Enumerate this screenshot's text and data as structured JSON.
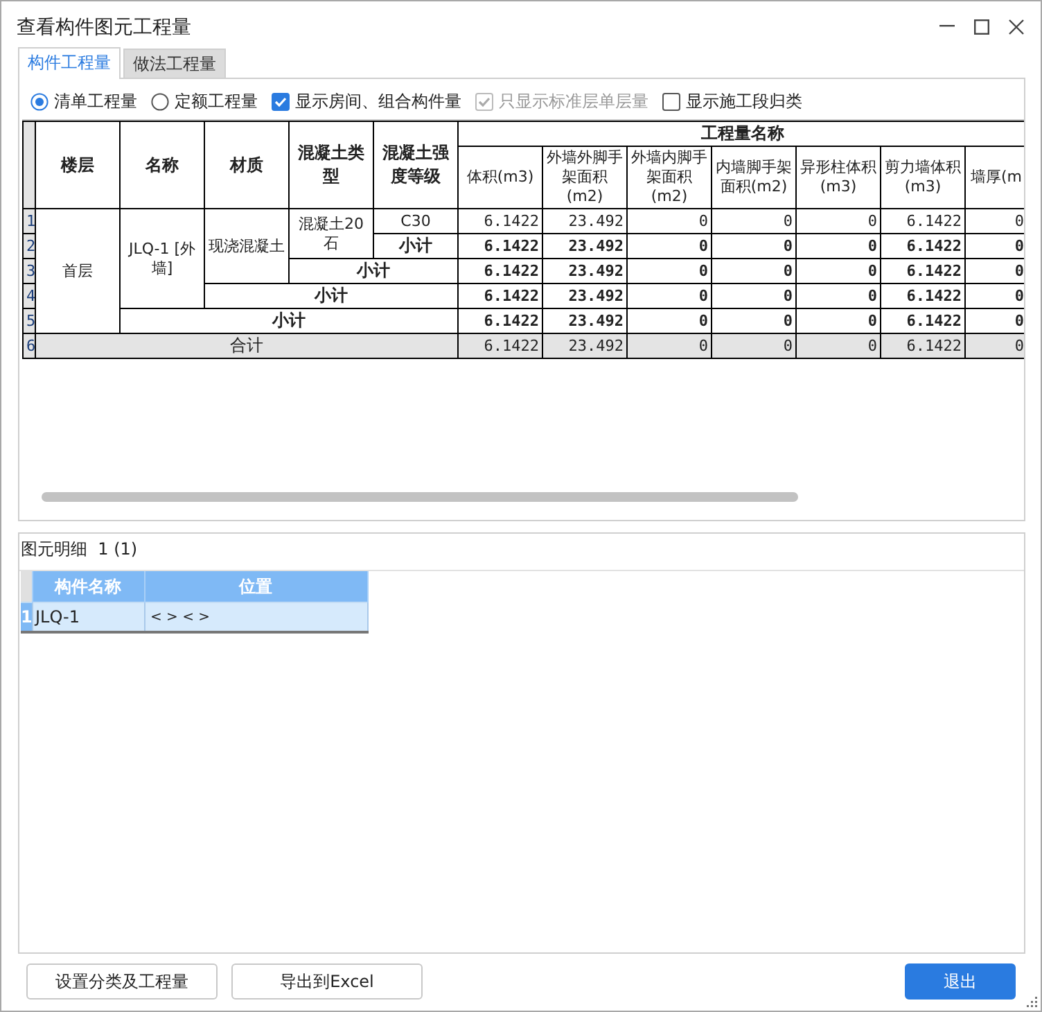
{
  "window": {
    "title": "查看构件图元工程量"
  },
  "tabs": [
    {
      "label": "构件工程量",
      "selected": true
    },
    {
      "label": "做法工程量",
      "selected": false
    }
  ],
  "options": [
    {
      "kind": "radio",
      "label": "清单工程量",
      "checked": true,
      "disabled": false
    },
    {
      "kind": "radio",
      "label": "定额工程量",
      "checked": false,
      "disabled": false
    },
    {
      "kind": "checkbox",
      "label": "显示房间、组合构件量",
      "checked": true,
      "disabled": false
    },
    {
      "kind": "checkbox",
      "label": "只显示标准层单层量",
      "checked": true,
      "disabled": true
    },
    {
      "kind": "checkbox",
      "label": "显示施工段归类",
      "checked": false,
      "disabled": false
    }
  ],
  "quantity_table": {
    "group_title": "工程量名称",
    "columns": [
      "楼层",
      "名称",
      "材质",
      "混凝土类型",
      "混凝土强度等级"
    ],
    "quantity_columns": [
      "体积(m3)",
      "外墙外脚手架面积(m2)",
      "外墙内脚手架面积(m2)",
      "内墙脚手架面积(m2)",
      "异形柱体积(m3)",
      "剪力墙体积(m3)",
      "墙厚(m"
    ],
    "rows": [
      {
        "number": "1",
        "kind": "detail",
        "cells": [
          "首层",
          "JLQ-1 [外墙]",
          "现浇混凝土",
          "混凝土20石",
          "C30"
        ],
        "values": [
          "6.1422",
          "23.492",
          "0",
          "0",
          "0",
          "6.1422",
          "0"
        ]
      },
      {
        "number": "2",
        "kind": "gradesum",
        "label": "小计",
        "values": [
          "6.1422",
          "23.492",
          "0",
          "0",
          "0",
          "6.1422",
          "0"
        ]
      },
      {
        "number": "3",
        "kind": "typesum",
        "label": "小计",
        "values": [
          "6.1422",
          "23.492",
          "0",
          "0",
          "0",
          "6.1422",
          "0"
        ]
      },
      {
        "number": "4",
        "kind": "materialsum",
        "label": "小计",
        "values": [
          "6.1422",
          "23.492",
          "0",
          "0",
          "0",
          "6.1422",
          "0"
        ]
      },
      {
        "number": "5",
        "kind": "namesum",
        "label": "小计",
        "values": [
          "6.1422",
          "23.492",
          "0",
          "0",
          "0",
          "6.1422",
          "0"
        ]
      },
      {
        "number": "6",
        "kind": "total",
        "label": "合计",
        "values": [
          "6.1422",
          "23.492",
          "0",
          "0",
          "0",
          "6.1422",
          "0"
        ]
      }
    ]
  },
  "detail_panel": {
    "title": "图元明细  1 (1)",
    "columns": [
      "构件名称",
      "位置"
    ],
    "rows": [
      {
        "number": "1",
        "selected": true,
        "cells": [
          "JLQ-1",
          "< > < >"
        ]
      }
    ]
  },
  "buttons": [
    {
      "kind": "secondary",
      "label": "设置分类及工程量"
    },
    {
      "kind": "secondary",
      "label": "导出到Excel"
    },
    {
      "kind": "primary",
      "label": "退出"
    }
  ]
}
